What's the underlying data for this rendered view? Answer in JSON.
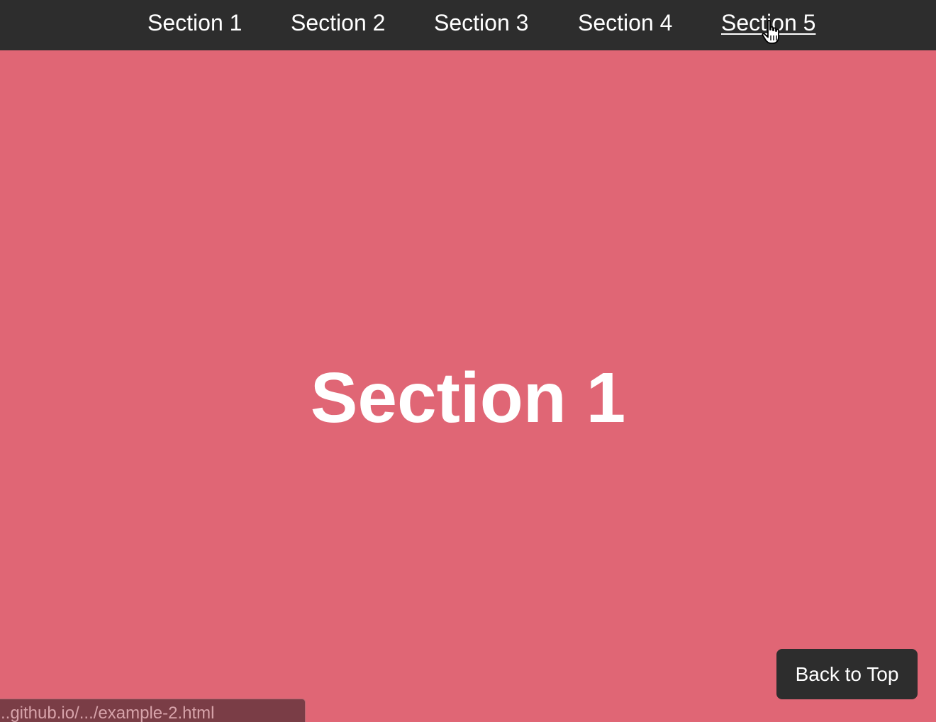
{
  "nav": {
    "links": [
      {
        "label": "Section 1"
      },
      {
        "label": "Section 2"
      },
      {
        "label": "Section 3"
      },
      {
        "label": "Section 4"
      },
      {
        "label": "Section 5",
        "hovered": true
      }
    ]
  },
  "main": {
    "section_title": "Section 1",
    "background_color": "#e06675"
  },
  "back_to_top": {
    "label": "Back to Top"
  },
  "status_bar": {
    "url": "..github.io/.../example-2.html"
  },
  "colors": {
    "navbar": "#2d2d2d",
    "section_background": "#e06675",
    "text": "#ffffff"
  },
  "cursor": {
    "icon": "hand-pointer-icon"
  }
}
